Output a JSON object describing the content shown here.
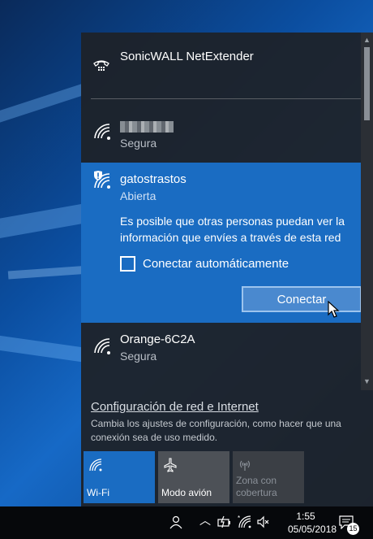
{
  "vpn": {
    "name": "SonicWALL NetExtender",
    "icon": "vpn-phone-icon"
  },
  "networks": [
    {
      "name": "",
      "status": "Segura",
      "icon": "wifi-icon",
      "name_obscured": true
    },
    {
      "name": "gatostrastos",
      "status": "Abierta",
      "icon": "wifi-shield-warning-icon",
      "warning": "Es posible que otras personas puedan ver la información que envíes a través de esta red",
      "auto_connect_label": "Conectar automáticamente",
      "auto_connect_checked": false,
      "connect_label": "Conectar"
    },
    {
      "name": "Orange-6C2A",
      "status": "Segura",
      "icon": "wifi-icon"
    }
  ],
  "settings": {
    "link": "Configuración de red e Internet",
    "description": "Cambia los ajustes de configuración, como hacer que una conexión sea de uso medido."
  },
  "quick_actions": [
    {
      "label": "Wi-Fi",
      "icon": "wifi-icon",
      "active": true
    },
    {
      "label": "Modo avión",
      "icon": "airplane-icon",
      "active": false
    },
    {
      "label": "Zona con cobertura",
      "icon": "hotspot-icon",
      "disabled": true
    }
  ],
  "taskbar": {
    "time": "1:55",
    "date": "05/05/2018",
    "notifications": "15"
  },
  "colors": {
    "accent": "#1a6cc2",
    "flyout_bg": "#1e2228",
    "taskbar_bg": "#06080b"
  }
}
